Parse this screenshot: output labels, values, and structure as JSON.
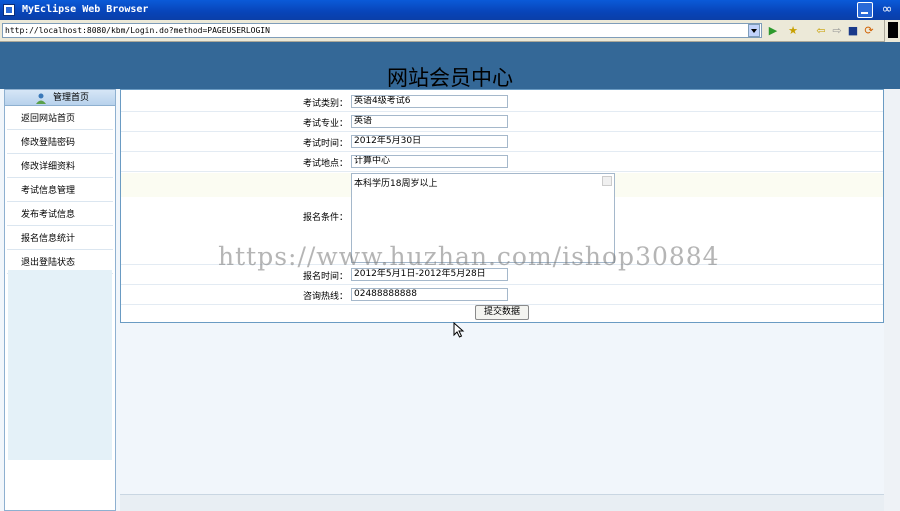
{
  "window": {
    "title": "MyEclipse Web Browser",
    "logo": "∞"
  },
  "addressbar": {
    "url": "http://localhost:8080/kbm/Login.do?method=PAGEUSERLOGIN"
  },
  "icons": {
    "go": "▶",
    "favorites": "★",
    "back": "⇦",
    "forward": "⇨",
    "stop": "■",
    "sync": "⟳"
  },
  "page": {
    "banner_title": "网站会员中心"
  },
  "sidebar": {
    "header": "管理首页",
    "items": [
      {
        "label": "返回网站首页"
      },
      {
        "label": "修改登陆密码"
      },
      {
        "label": "修改详细资料"
      },
      {
        "label": "考试信息管理"
      },
      {
        "label": "发布考试信息"
      },
      {
        "label": "报名信息统计"
      },
      {
        "label": "退出登陆状态"
      }
    ]
  },
  "form": {
    "exam_type": {
      "label": "考试类别：",
      "value": "英语4级考试6"
    },
    "exam_major": {
      "label": "考试专业：",
      "value": "英语"
    },
    "exam_time": {
      "label": "考试时间：",
      "value": "2012年5月30日"
    },
    "exam_place": {
      "label": "考试地点：",
      "value": "计算中心"
    },
    "conditions": {
      "label": "报名条件：",
      "value": "本科学历18周岁以上"
    },
    "signup_time": {
      "label": "报名时间：",
      "value": "2012年5月1日-2012年5月28日"
    },
    "hotline": {
      "label": "咨询热线：",
      "value": "02488888888"
    },
    "submit_label": "提交数据"
  },
  "watermark": "https://www.huzhan.com/ishop30884"
}
